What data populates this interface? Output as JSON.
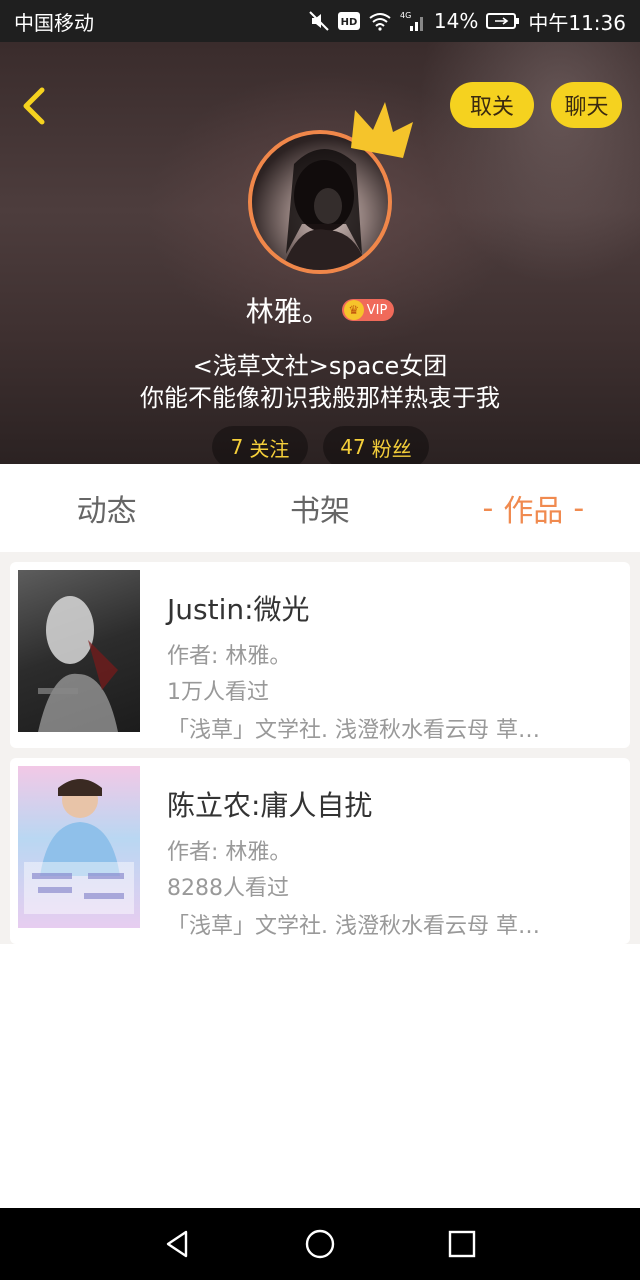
{
  "status_bar": {
    "carrier": "中国移动",
    "battery": "14%",
    "time": "中午11:36",
    "hd_label": "HD",
    "network_label": "4G",
    "icons": [
      "mute-icon",
      "hd-icon",
      "wifi-icon",
      "signal-icon",
      "battery-icon"
    ]
  },
  "header": {
    "back_icon": "back-arrow-icon",
    "unfollow_label": "取关",
    "chat_label": "聊天",
    "username": "林雅。",
    "vip_label": "VIP",
    "bio_line1": "<浅草文社>space女团",
    "bio_line2": "你能不能像初识我般那样热衷于我",
    "following_count": "7",
    "following_label": "关注",
    "fans_count": "47",
    "fans_label": "粉丝",
    "accent_color": "#f5d21f"
  },
  "tabs": [
    {
      "label": "动态",
      "active": false
    },
    {
      "label": "书架",
      "active": false
    },
    {
      "label": "作品",
      "active": true
    }
  ],
  "books": [
    {
      "title": "Justin:微光",
      "author": "作者: 林雅。",
      "views": "1万人看过",
      "tags": "「浅草」文学社. 浅澄秋水看云母  草…"
    },
    {
      "title": "陈立农:庸人自扰",
      "author": "作者: 林雅。",
      "views": "8288人看过",
      "tags": "「浅草」文学社. 浅澄秋水看云母  草…"
    }
  ],
  "nav": {
    "icons": [
      "nav-back-icon",
      "nav-home-icon",
      "nav-recent-icon"
    ]
  }
}
